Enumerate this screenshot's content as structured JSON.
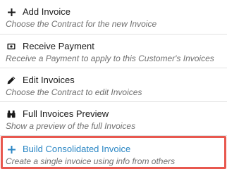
{
  "menu": {
    "items": [
      {
        "icon": "plus-icon",
        "label": "Add Invoice",
        "description": "Choose the Contract for the new Invoice"
      },
      {
        "icon": "money-icon",
        "label": "Receive Payment",
        "description": "Receive a Payment to apply to this Customer's Invoices"
      },
      {
        "icon": "pencil-icon",
        "label": "Edit Invoices",
        "description": "Choose the Contract to edit Invoices"
      },
      {
        "icon": "binoculars-icon",
        "label": "Full Invoices Preview",
        "description": "Show a preview of the full Invoices"
      },
      {
        "icon": "plus-icon",
        "label": "Build Consolidated Invoice",
        "description": "Create a single invoice using info from others",
        "highlighted": true
      }
    ]
  },
  "colors": {
    "text": "#1a1a1a",
    "description": "#707070",
    "accent": "#2a86c4",
    "highlight_border": "#e8584f",
    "divider": "#e2e2e2"
  }
}
